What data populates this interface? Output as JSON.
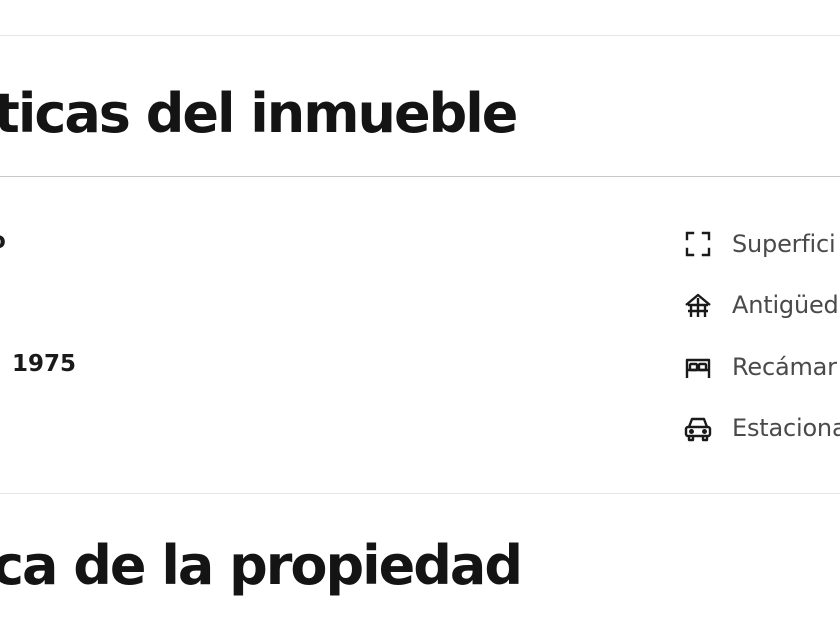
{
  "section_main": {
    "title": "ticas del inmueble"
  },
  "left_column": {
    "value_1": "o",
    "value_2": "1975"
  },
  "features": [
    {
      "icon": "expand-corners-icon",
      "label": "Superfici"
    },
    {
      "icon": "building-age-icon",
      "label": "Antigüed"
    },
    {
      "icon": "bed-icon",
      "label": "Recámar"
    },
    {
      "icon": "car-icon",
      "label": "Estaciona"
    }
  ],
  "section_second": {
    "title": "ca de la propiedad"
  }
}
